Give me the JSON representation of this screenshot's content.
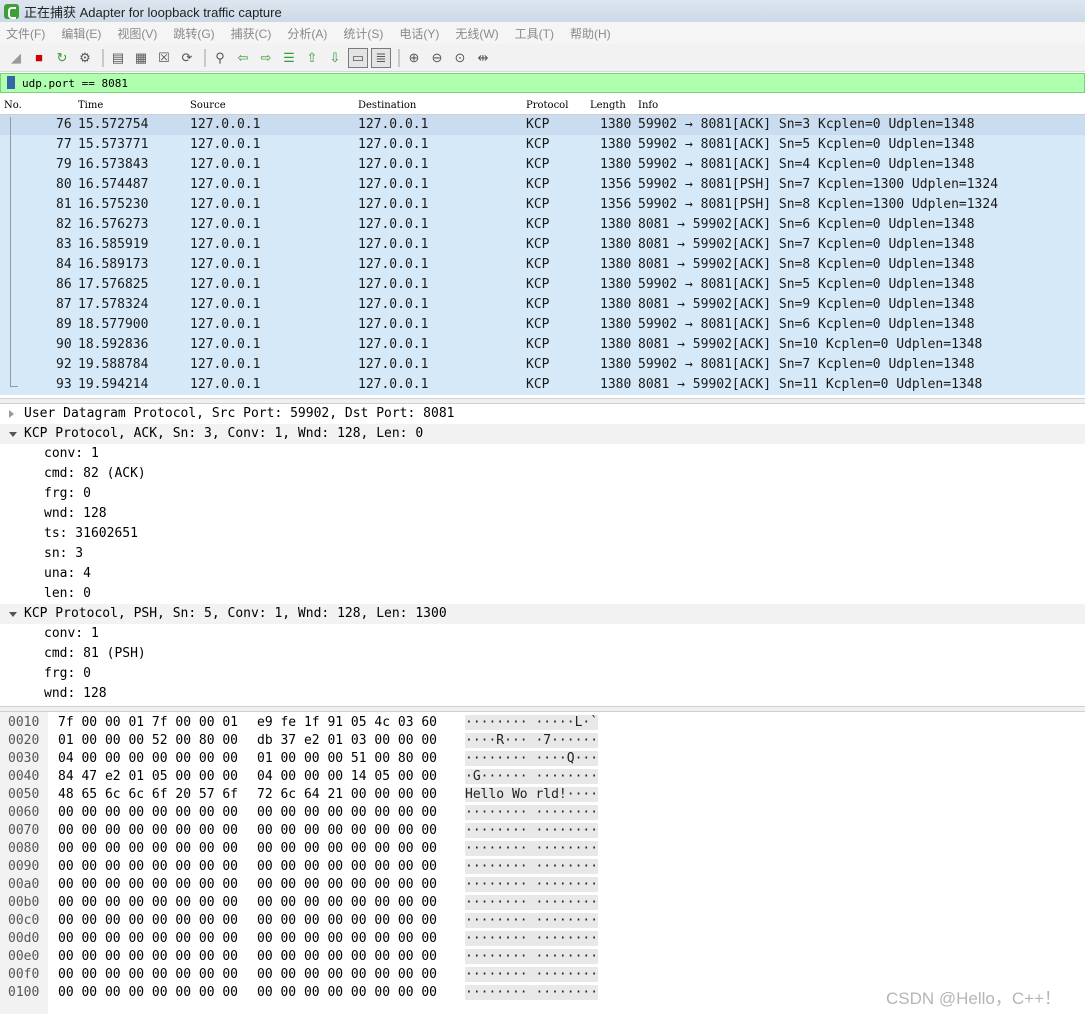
{
  "window": {
    "title": "正在捕获 Adapter for loopback traffic capture"
  },
  "menu": [
    "文件(F)",
    "编辑(E)",
    "视图(V)",
    "跳转(G)",
    "捕获(C)",
    "分析(A)",
    "统计(S)",
    "电话(Y)",
    "无线(W)",
    "工具(T)",
    "帮助(H)"
  ],
  "toolbar": {
    "icons": [
      "shark-fin-icon",
      "stop-icon",
      "restart-icon",
      "options-icon",
      "open-file-icon",
      "save-file-icon",
      "close-file-icon",
      "reload-icon",
      "find-icon",
      "back-icon",
      "forward-icon",
      "goto-icon",
      "first-icon",
      "last-icon",
      "autoscroll-icon",
      "colorize-icon",
      "zoom-in-icon",
      "zoom-out-icon",
      "zoom-normal-icon",
      "resize-columns-icon"
    ]
  },
  "filter": {
    "value": "udp.port == 8081"
  },
  "columns": [
    "No.",
    "Time",
    "Source",
    "Destination",
    "Protocol",
    "Length",
    "Info"
  ],
  "packets": [
    {
      "no": "76",
      "time": "15.572754",
      "src": "127.0.0.1",
      "dst": "127.0.0.1",
      "proto": "KCP",
      "len": "1380",
      "info": "59902 → 8081[ACK] Sn=3 Kcplen=0 Udplen=1348"
    },
    {
      "no": "77",
      "time": "15.573771",
      "src": "127.0.0.1",
      "dst": "127.0.0.1",
      "proto": "KCP",
      "len": "1380",
      "info": "59902 → 8081[ACK] Sn=5 Kcplen=0 Udplen=1348"
    },
    {
      "no": "79",
      "time": "16.573843",
      "src": "127.0.0.1",
      "dst": "127.0.0.1",
      "proto": "KCP",
      "len": "1380",
      "info": "59902 → 8081[ACK] Sn=4 Kcplen=0 Udplen=1348"
    },
    {
      "no": "80",
      "time": "16.574487",
      "src": "127.0.0.1",
      "dst": "127.0.0.1",
      "proto": "KCP",
      "len": "1356",
      "info": "59902 → 8081[PSH] Sn=7 Kcplen=1300 Udplen=1324"
    },
    {
      "no": "81",
      "time": "16.575230",
      "src": "127.0.0.1",
      "dst": "127.0.0.1",
      "proto": "KCP",
      "len": "1356",
      "info": "59902 → 8081[PSH] Sn=8 Kcplen=1300 Udplen=1324"
    },
    {
      "no": "82",
      "time": "16.576273",
      "src": "127.0.0.1",
      "dst": "127.0.0.1",
      "proto": "KCP",
      "len": "1380",
      "info": "8081 → 59902[ACK] Sn=6 Kcplen=0 Udplen=1348"
    },
    {
      "no": "83",
      "time": "16.585919",
      "src": "127.0.0.1",
      "dst": "127.0.0.1",
      "proto": "KCP",
      "len": "1380",
      "info": "8081 → 59902[ACK] Sn=7 Kcplen=0 Udplen=1348"
    },
    {
      "no": "84",
      "time": "16.589173",
      "src": "127.0.0.1",
      "dst": "127.0.0.1",
      "proto": "KCP",
      "len": "1380",
      "info": "8081 → 59902[ACK] Sn=8 Kcplen=0 Udplen=1348"
    },
    {
      "no": "86",
      "time": "17.576825",
      "src": "127.0.0.1",
      "dst": "127.0.0.1",
      "proto": "KCP",
      "len": "1380",
      "info": "59902 → 8081[ACK] Sn=5 Kcplen=0 Udplen=1348"
    },
    {
      "no": "87",
      "time": "17.578324",
      "src": "127.0.0.1",
      "dst": "127.0.0.1",
      "proto": "KCP",
      "len": "1380",
      "info": "8081 → 59902[ACK] Sn=9 Kcplen=0 Udplen=1348"
    },
    {
      "no": "89",
      "time": "18.577900",
      "src": "127.0.0.1",
      "dst": "127.0.0.1",
      "proto": "KCP",
      "len": "1380",
      "info": "59902 → 8081[ACK] Sn=6 Kcplen=0 Udplen=1348"
    },
    {
      "no": "90",
      "time": "18.592836",
      "src": "127.0.0.1",
      "dst": "127.0.0.1",
      "proto": "KCP",
      "len": "1380",
      "info": "8081 → 59902[ACK] Sn=10 Kcplen=0 Udplen=1348"
    },
    {
      "no": "92",
      "time": "19.588784",
      "src": "127.0.0.1",
      "dst": "127.0.0.1",
      "proto": "KCP",
      "len": "1380",
      "info": "59902 → 8081[ACK] Sn=7 Kcplen=0 Udplen=1348"
    },
    {
      "no": "93",
      "time": "19.594214",
      "src": "127.0.0.1",
      "dst": "127.0.0.1",
      "proto": "KCP",
      "len": "1380",
      "info": "8081 → 59902[ACK] Sn=11 Kcplen=0 Udplen=1348"
    }
  ],
  "details": [
    {
      "text": "User Datagram Protocol, Src Port: 59902, Dst Port: 8081",
      "level": 0,
      "expanded": false
    },
    {
      "text": "KCP Protocol, ACK, Sn: 3, Conv: 1, Wnd: 128, Len: 0",
      "level": 0,
      "expanded": true
    },
    {
      "text": "conv: 1",
      "level": 1
    },
    {
      "text": "cmd: 82 (ACK)",
      "level": 1
    },
    {
      "text": "frg: 0",
      "level": 1
    },
    {
      "text": "wnd: 128",
      "level": 1
    },
    {
      "text": "ts: 31602651",
      "level": 1
    },
    {
      "text": "sn: 3",
      "level": 1
    },
    {
      "text": "una: 4",
      "level": 1
    },
    {
      "text": "len: 0",
      "level": 1
    },
    {
      "text": "KCP Protocol, PSH, Sn: 5, Conv: 1, Wnd: 128, Len: 1300",
      "level": 0,
      "expanded": true
    },
    {
      "text": "conv: 1",
      "level": 1
    },
    {
      "text": "cmd: 81 (PSH)",
      "level": 1
    },
    {
      "text": "frg: 0",
      "level": 1
    },
    {
      "text": "wnd: 128",
      "level": 1
    }
  ],
  "hex": [
    {
      "off": "0010",
      "b1": "7f 00 00 01 7f 00 00 01",
      "b2": "e9 fe 1f 91 05 4c 03 60",
      "asc": "········ ·····L·`"
    },
    {
      "off": "0020",
      "b1": "01 00 00 00 52 00 80 00",
      "b2": "db 37 e2 01 03 00 00 00",
      "asc": "····R··· ·7······"
    },
    {
      "off": "0030",
      "b1": "04 00 00 00 00 00 00 00",
      "b2": "01 00 00 00 51 00 80 00",
      "asc": "········ ····Q···"
    },
    {
      "off": "0040",
      "b1": "84 47 e2 01 05 00 00 00",
      "b2": "04 00 00 00 14 05 00 00",
      "asc": "·G······ ········"
    },
    {
      "off": "0050",
      "b1": "48 65 6c 6c 6f 20 57 6f",
      "b2": "72 6c 64 21 00 00 00 00",
      "asc": "Hello Wo rld!····"
    },
    {
      "off": "0060",
      "b1": "00 00 00 00 00 00 00 00",
      "b2": "00 00 00 00 00 00 00 00",
      "asc": "········ ········"
    },
    {
      "off": "0070",
      "b1": "00 00 00 00 00 00 00 00",
      "b2": "00 00 00 00 00 00 00 00",
      "asc": "········ ········"
    },
    {
      "off": "0080",
      "b1": "00 00 00 00 00 00 00 00",
      "b2": "00 00 00 00 00 00 00 00",
      "asc": "········ ········"
    },
    {
      "off": "0090",
      "b1": "00 00 00 00 00 00 00 00",
      "b2": "00 00 00 00 00 00 00 00",
      "asc": "········ ········"
    },
    {
      "off": "00a0",
      "b1": "00 00 00 00 00 00 00 00",
      "b2": "00 00 00 00 00 00 00 00",
      "asc": "········ ········"
    },
    {
      "off": "00b0",
      "b1": "00 00 00 00 00 00 00 00",
      "b2": "00 00 00 00 00 00 00 00",
      "asc": "········ ········"
    },
    {
      "off": "00c0",
      "b1": "00 00 00 00 00 00 00 00",
      "b2": "00 00 00 00 00 00 00 00",
      "asc": "········ ········"
    },
    {
      "off": "00d0",
      "b1": "00 00 00 00 00 00 00 00",
      "b2": "00 00 00 00 00 00 00 00",
      "asc": "········ ········"
    },
    {
      "off": "00e0",
      "b1": "00 00 00 00 00 00 00 00",
      "b2": "00 00 00 00 00 00 00 00",
      "asc": "········ ········"
    },
    {
      "off": "00f0",
      "b1": "00 00 00 00 00 00 00 00",
      "b2": "00 00 00 00 00 00 00 00",
      "asc": "········ ········"
    },
    {
      "off": "0100",
      "b1": "00 00 00 00 00 00 00 00",
      "b2": "00 00 00 00 00 00 00 00",
      "asc": "········ ········"
    }
  ],
  "watermark": "CSDN @Hello，C++！",
  "colors": {
    "filter_ok": "#afffaf",
    "row_bg": "#d6e9f8"
  }
}
